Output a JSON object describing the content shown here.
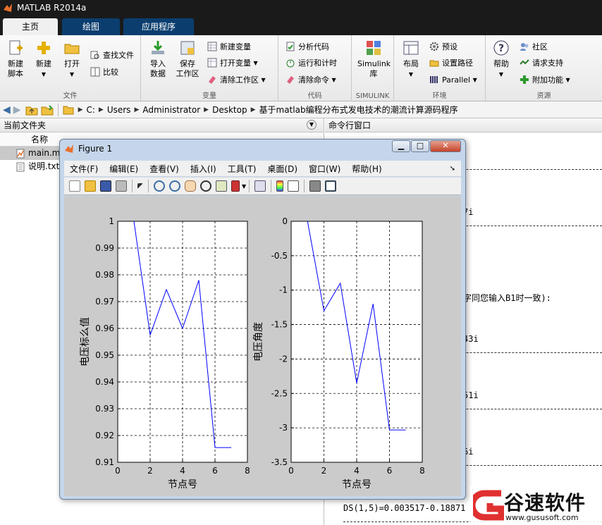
{
  "window": {
    "title": "MATLAB R2014a"
  },
  "tabs": [
    {
      "label": "主页"
    },
    {
      "label": "绘图"
    },
    {
      "label": "应用程序"
    }
  ],
  "ribbon": {
    "file": {
      "label": "文件",
      "new_script": "新建\n脚本",
      "new": "新建",
      "open": "打开",
      "find_files": "查找文件",
      "compare": "比较"
    },
    "variable": {
      "label": "变量",
      "import_data": "导入\n数据",
      "save_workspace": "保存\n工作区",
      "new_variable": "新建变量",
      "open_variable": "打开变量",
      "clear_workspace": "清除工作区"
    },
    "code": {
      "label": "代码",
      "analyze_code": "分析代码",
      "run_and_time": "运行和计时",
      "clear_commands": "清除命令"
    },
    "simulink": {
      "label": "SIMULINK",
      "library": "Simulink\n库"
    },
    "environment": {
      "label": "环境",
      "layout": "布局",
      "preferences": "预设",
      "set_path": "设置路径",
      "parallel": "Parallel"
    },
    "resources": {
      "label": "资源",
      "help": "帮助",
      "community": "社区",
      "request_support": "请求支持",
      "add_ons": "附加功能"
    }
  },
  "address": {
    "segments": [
      "C:",
      "Users",
      "Administrator",
      "Desktop",
      "基于matlab编程分布式发电技术的潮流计算源码程序"
    ]
  },
  "current_folder": {
    "title": "当前文件夹",
    "column_name": "名称",
    "files": [
      {
        "name": "main.m",
        "selected": true
      },
      {
        "name": "说明.txt",
        "selected": false
      }
    ]
  },
  "command_window": {
    "title": "命令行窗口",
    "lines": [
      {
        "text": "7i"
      },
      {
        "text": "字同您输入B1时一致):"
      },
      {
        "text": "43i"
      },
      {
        "text": "51i"
      },
      {
        "text": "6i"
      },
      {
        "text": "DS(1,5)=0.003517-0.18871"
      }
    ]
  },
  "figure": {
    "title": "Figure 1",
    "menu": [
      "文件(F)",
      "编辑(E)",
      "查看(V)",
      "插入(I)",
      "工具(T)",
      "桌面(D)",
      "窗口(W)",
      "帮助(H)"
    ]
  },
  "chart_data": [
    {
      "type": "line",
      "title": "",
      "xlabel": "节点号",
      "ylabel": "电压标么值",
      "xlim": [
        0,
        8
      ],
      "ylim": [
        0.91,
        1
      ],
      "xticks": [
        "0",
        "2",
        "4",
        "6",
        "8"
      ],
      "yticks": [
        "0.91",
        "0.92",
        "0.93",
        "0.94",
        "0.95",
        "0.96",
        "0.97",
        "0.98",
        "0.99",
        "1"
      ],
      "grid": true,
      "color": "#0000ff",
      "x": [
        1,
        2,
        3,
        4,
        5,
        6,
        7
      ],
      "y": [
        1.0,
        0.9575,
        0.9745,
        0.96,
        0.978,
        0.9155,
        0.9155
      ]
    },
    {
      "type": "line",
      "title": "",
      "xlabel": "节点号",
      "ylabel": "电压角度",
      "xlim": [
        0,
        8
      ],
      "ylim": [
        -3.5,
        0
      ],
      "xticks": [
        "0",
        "2",
        "4",
        "6",
        "8"
      ],
      "yticks": [
        "-3.5",
        "-3",
        "-2.5",
        "-2",
        "-1.5",
        "-1",
        "-0.5",
        "0"
      ],
      "grid": true,
      "color": "#0000ff",
      "x": [
        1,
        2,
        3,
        4,
        5,
        6,
        7
      ],
      "y": [
        0,
        -1.3,
        -0.9,
        -2.35,
        -1.2,
        -3.03,
        -3.03
      ]
    }
  ],
  "watermark": {
    "text": "谷速软件",
    "url": "www.gususoft.com"
  }
}
